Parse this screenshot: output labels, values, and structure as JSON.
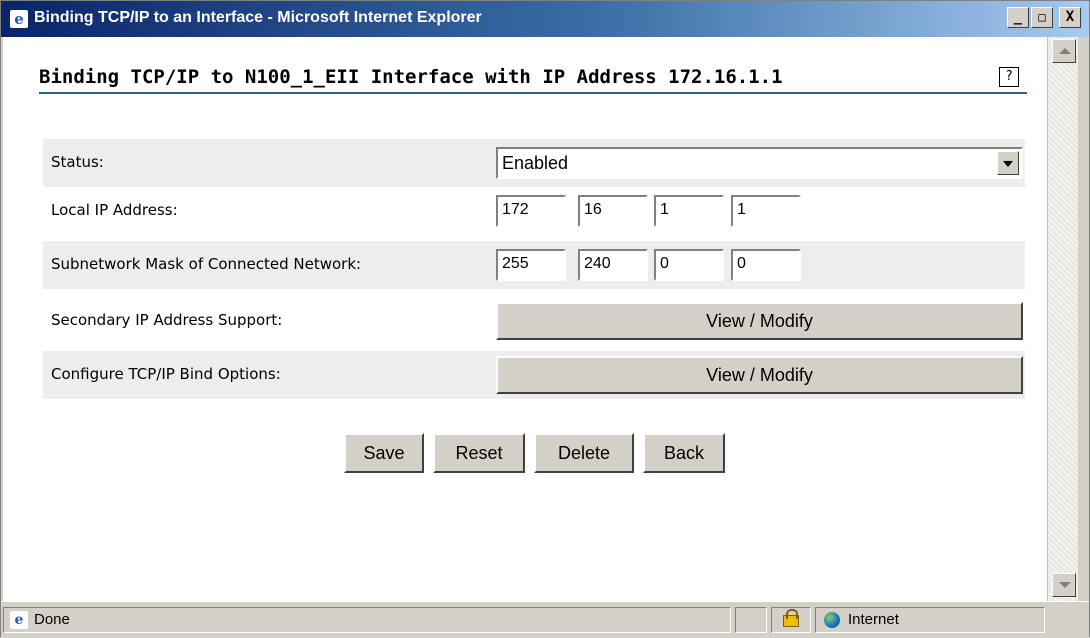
{
  "window": {
    "title": "Binding TCP/IP to an Interface - Microsoft Internet Explorer",
    "minimize": "_",
    "maximize": "□",
    "close": "X"
  },
  "page": {
    "title": "Binding TCP/IP to N100_1_EII Interface with IP Address 172.16.1.1",
    "help": "?"
  },
  "form": {
    "status": {
      "label": "Status:",
      "value": "Enabled"
    },
    "local_ip": {
      "label": "Local IP Address:",
      "octets": [
        "172",
        "16",
        "1",
        "1"
      ]
    },
    "subnet_mask": {
      "label": "Subnetwork Mask of Connected Network:",
      "octets": [
        "255",
        "240",
        "0",
        "0"
      ]
    },
    "secondary_ip": {
      "label": "Secondary IP Address Support:",
      "button": "View / Modify"
    },
    "bind_options": {
      "label": "Configure TCP/IP Bind Options:",
      "button": "View / Modify"
    }
  },
  "actions": {
    "save": "Save",
    "reset": "Reset",
    "delete": "Delete",
    "back": "Back"
  },
  "statusbar": {
    "text": "Done",
    "zone": "Internet"
  },
  "icons": [
    "ie-icon",
    "help-icon",
    "lock-icon",
    "globe-icon",
    "dropdown-arrow-icon",
    "scroll-up-icon",
    "scroll-down-icon"
  ]
}
